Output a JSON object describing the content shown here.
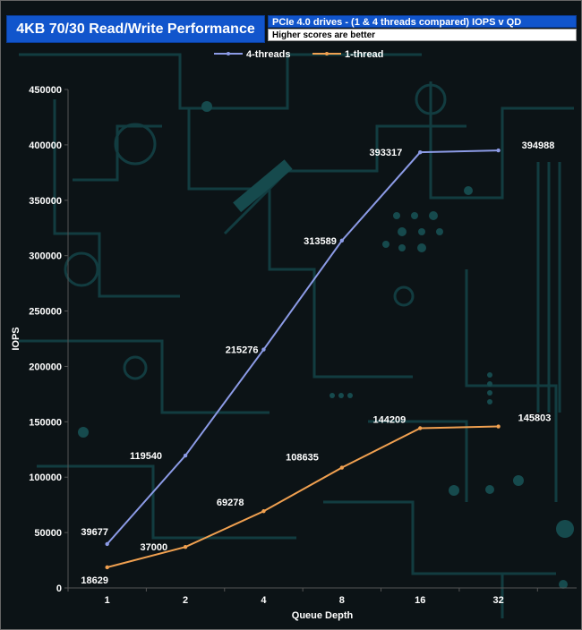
{
  "header": {
    "title": "4KB 70/30 Read/Write Performance",
    "subtitle": "PCIe 4.0 drives - (1 & 4 threads compared) IOPS v QD",
    "note": "Higher scores are better"
  },
  "colors": {
    "series_4threads": "#8c9be6",
    "series_1thread": "#f0a050",
    "title_bg": "#1155cc"
  },
  "chart_data": {
    "type": "line",
    "categories": [
      "1",
      "2",
      "4",
      "8",
      "16",
      "32"
    ],
    "series": [
      {
        "name": "4-threads",
        "values": [
          39677,
          119540,
          215276,
          313589,
          393317,
          394988
        ]
      },
      {
        "name": "1-thread",
        "values": [
          18629,
          37000,
          69278,
          108635,
          144209,
          145803
        ]
      }
    ],
    "xlabel": "Queue Depth",
    "ylabel": "IOPS",
    "ylim": [
      0,
      450000
    ],
    "yticks": [
      0,
      50000,
      100000,
      150000,
      200000,
      250000,
      300000,
      350000,
      400000,
      450000
    ],
    "grid": false,
    "legend": "top-center"
  }
}
